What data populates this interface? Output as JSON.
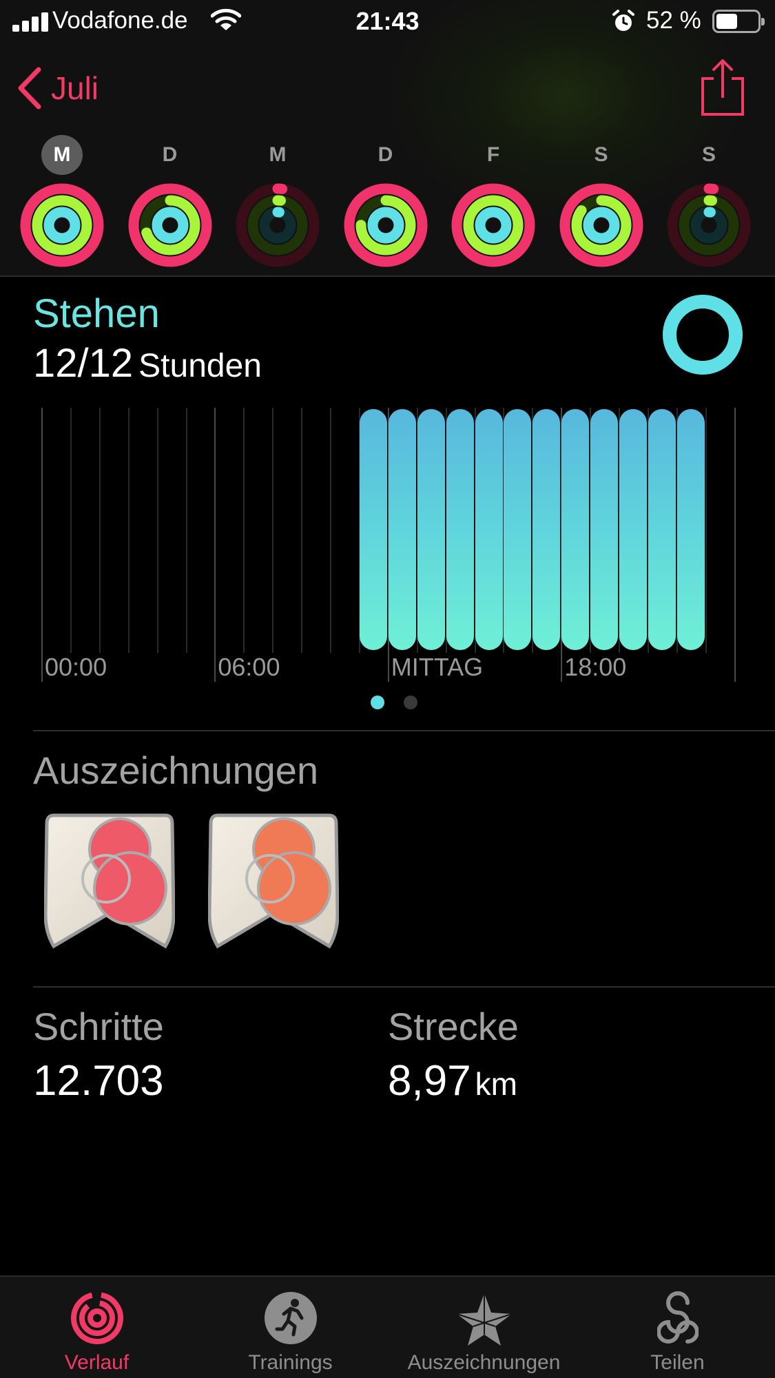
{
  "status_bar": {
    "carrier": "Vodafone.de",
    "time": "21:43",
    "battery_percent": "52 %",
    "battery_level": 0.52
  },
  "nav": {
    "back_label": "Juli"
  },
  "week": [
    {
      "letter": "M",
      "selected": true,
      "move": 1.0,
      "exercise": 1.0,
      "stand": 1.0
    },
    {
      "letter": "D",
      "selected": false,
      "move": 1.0,
      "exercise": 0.7,
      "stand": 1.0
    },
    {
      "letter": "M",
      "selected": false,
      "move": 0.02,
      "exercise": 0.02,
      "stand": 0.02
    },
    {
      "letter": "D",
      "selected": false,
      "move": 1.0,
      "exercise": 0.75,
      "stand": 1.0
    },
    {
      "letter": "F",
      "selected": false,
      "move": 1.0,
      "exercise": 1.0,
      "stand": 1.0
    },
    {
      "letter": "S",
      "selected": false,
      "move": 1.0,
      "exercise": 0.85,
      "stand": 1.0
    },
    {
      "letter": "S",
      "selected": false,
      "move": 0.02,
      "exercise": 0.02,
      "stand": 0.02
    }
  ],
  "stand": {
    "title": "Stehen",
    "value": "12/12",
    "unit": "Stunden",
    "progress": 1.0
  },
  "chart_data": {
    "type": "bar",
    "x": [
      0,
      1,
      2,
      3,
      4,
      5,
      6,
      7,
      8,
      9,
      10,
      11,
      12,
      13,
      14,
      15,
      16,
      17,
      18,
      19,
      20,
      21,
      22,
      23
    ],
    "values": [
      0,
      0,
      0,
      0,
      0,
      0,
      0,
      0,
      0,
      0,
      0,
      1,
      1,
      1,
      1,
      1,
      1,
      1,
      1,
      1,
      1,
      1,
      1,
      0
    ],
    "tick_labels": [
      {
        "hour": 0,
        "label": "00:00"
      },
      {
        "hour": 6,
        "label": "06:00"
      },
      {
        "hour": 12,
        "label": "MITTAG"
      },
      {
        "hour": 18,
        "label": "18:00"
      }
    ],
    "ylim": [
      0,
      1
    ],
    "grid": true
  },
  "pager": {
    "count": 2,
    "active": 0
  },
  "awards": {
    "title": "Auszeichnungen",
    "badges": [
      {
        "icon": "perfect-week-stand-badge-icon",
        "color": "#ee5a68"
      },
      {
        "icon": "perfect-week-exercise-badge-icon",
        "color": "#ef7a55"
      }
    ]
  },
  "stats": {
    "steps_label": "Schritte",
    "steps_value": "12.703",
    "distance_label": "Strecke",
    "distance_value": "8,97",
    "distance_unit": "km"
  },
  "tabs": [
    {
      "label": "Verlauf",
      "icon": "activity-rings-icon",
      "active": true
    },
    {
      "label": "Trainings",
      "icon": "running-figure-icon",
      "active": false
    },
    {
      "label": "Auszeichnungen",
      "icon": "star-award-icon",
      "active": false
    },
    {
      "label": "Teilen",
      "icon": "sharing-icon",
      "active": false
    }
  ],
  "colors": {
    "accent": "#f33a67",
    "move": "#f0336b",
    "exercise": "#a9f53c",
    "stand": "#5fe0e6"
  }
}
